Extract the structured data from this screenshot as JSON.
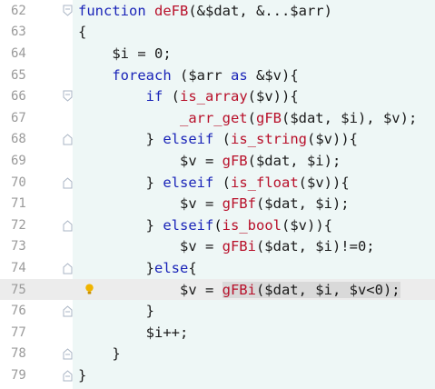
{
  "editor": {
    "lines": [
      {
        "n": "62",
        "parts": [
          [
            "kw",
            "function "
          ],
          [
            "fn",
            "deFB"
          ],
          [
            "t",
            "(&$dat, &...$arr)"
          ]
        ]
      },
      {
        "n": "63",
        "parts": [
          [
            "t",
            "{"
          ]
        ]
      },
      {
        "n": "64",
        "parts": [
          [
            "t",
            "    $i = 0;"
          ]
        ]
      },
      {
        "n": "65",
        "parts": [
          [
            "t",
            "    "
          ],
          [
            "kw",
            "foreach"
          ],
          [
            "t",
            " ($arr "
          ],
          [
            "kw",
            "as"
          ],
          [
            "t",
            " &$v){"
          ]
        ]
      },
      {
        "n": "66",
        "parts": [
          [
            "t",
            "        "
          ],
          [
            "kw",
            "if"
          ],
          [
            "t",
            " ("
          ],
          [
            "fn",
            "is_array"
          ],
          [
            "t",
            "($v)){"
          ]
        ]
      },
      {
        "n": "67",
        "parts": [
          [
            "t",
            "            "
          ],
          [
            "fn",
            "_arr_get"
          ],
          [
            "t",
            "("
          ],
          [
            "fn",
            "gFB"
          ],
          [
            "t",
            "($dat, $i), $v);"
          ]
        ]
      },
      {
        "n": "68",
        "parts": [
          [
            "t",
            "        } "
          ],
          [
            "kw",
            "elseif"
          ],
          [
            "t",
            " ("
          ],
          [
            "fn",
            "is_string"
          ],
          [
            "t",
            "($v)){"
          ]
        ]
      },
      {
        "n": "69",
        "parts": [
          [
            "t",
            "            $v = "
          ],
          [
            "fn",
            "gFB"
          ],
          [
            "t",
            "($dat, $i);"
          ]
        ]
      },
      {
        "n": "70",
        "parts": [
          [
            "t",
            "        } "
          ],
          [
            "kw",
            "elseif"
          ],
          [
            "t",
            " ("
          ],
          [
            "fn",
            "is_float"
          ],
          [
            "t",
            "($v)){"
          ]
        ]
      },
      {
        "n": "71",
        "parts": [
          [
            "t",
            "            $v = "
          ],
          [
            "fn",
            "gFBf"
          ],
          [
            "t",
            "($dat, $i);"
          ]
        ]
      },
      {
        "n": "72",
        "parts": [
          [
            "t",
            "        } "
          ],
          [
            "kw",
            "elseif"
          ],
          [
            "t",
            "("
          ],
          [
            "fn",
            "is_bool"
          ],
          [
            "t",
            "($v)){"
          ]
        ]
      },
      {
        "n": "73",
        "parts": [
          [
            "t",
            "            $v = "
          ],
          [
            "fn",
            "gFBi"
          ],
          [
            "t",
            "($dat, $i)!=0;"
          ]
        ]
      },
      {
        "n": "74",
        "parts": [
          [
            "t",
            "        }"
          ],
          [
            "kw",
            "else"
          ],
          [
            "t",
            "{"
          ]
        ]
      },
      {
        "n": "75",
        "parts": [
          [
            "t",
            "            $v = "
          ],
          [
            "sel",
            "gFBi($dat, $i, $v<0);"
          ]
        ]
      },
      {
        "n": "76",
        "parts": [
          [
            "t",
            "        }"
          ]
        ]
      },
      {
        "n": "77",
        "parts": [
          [
            "t",
            "        $i++;"
          ]
        ]
      },
      {
        "n": "78",
        "parts": [
          [
            "t",
            "    }"
          ]
        ]
      },
      {
        "n": "79",
        "parts": [
          [
            "t",
            "}"
          ]
        ]
      }
    ],
    "current_line": "75",
    "fold_icons": {
      "62": "fold-open-icon",
      "66": "fold-open-icon",
      "68": "fold-close-icon",
      "70": "fold-close-icon",
      "72": "fold-close-icon",
      "74": "fold-close-icon",
      "76": "fold-end-icon",
      "78": "fold-end-icon",
      "79": "fold-end-icon"
    },
    "bulb_line": "75"
  },
  "colors": {
    "keyword": "#1a24b8",
    "function": "#b8102a",
    "text": "#1a1a1a",
    "line_number": "#9a9a9a",
    "current_line_bg": "#ececec",
    "code_bg": "#eef7f6",
    "bulb": "#f0b400"
  }
}
